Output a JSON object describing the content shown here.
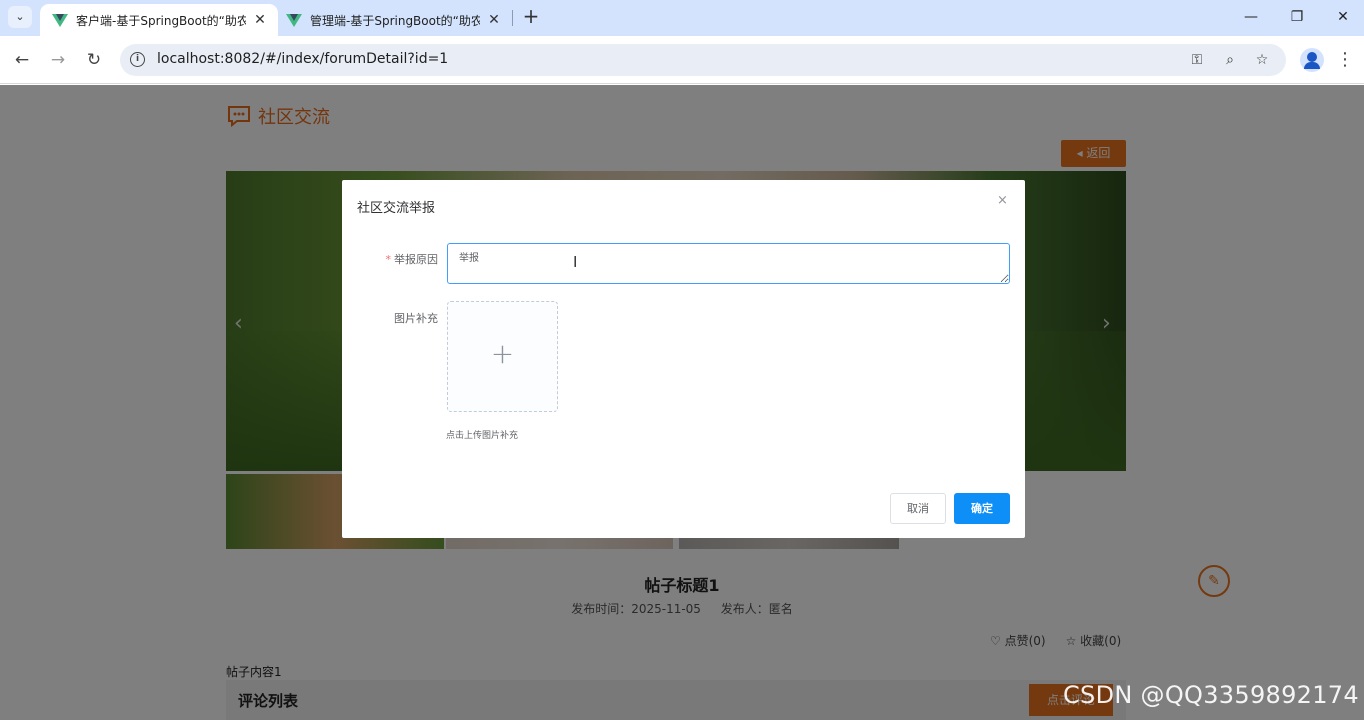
{
  "browser": {
    "tabs": [
      {
        "title": "客户端-基于SpringBoot的“助农",
        "active": true
      },
      {
        "title": "管理端-基于SpringBoot的“助农",
        "active": false
      }
    ],
    "url": "localhost:8082/#/index/forumDetail?id=1",
    "icons": [
      "tab-search-icon",
      "vue-favicon",
      "close-icon",
      "new-tab-icon",
      "minimize-icon",
      "restore-icon",
      "close-window-icon",
      "back-icon",
      "forward-icon",
      "reload-icon",
      "site-info-icon",
      "password-key-icon",
      "zoom-icon",
      "bookmark-star-icon",
      "profile-icon",
      "menu-icon"
    ]
  },
  "page": {
    "section_title": "社区交流",
    "back_label": "返回",
    "post_title": "帖子标题1",
    "publish_time_label": "发布时间：2025-11-05",
    "publisher_label": "发布人：匿名",
    "like_label": "点赞(0)",
    "favorite_label": "收藏(0)",
    "content": "帖子内容1",
    "comment_list_title": "评论列表",
    "comment_button": "点击评论"
  },
  "dialog": {
    "title": "社区交流举报",
    "close_symbol": "×",
    "reason_label": "举报原因",
    "reason_value": "举报",
    "image_label": "图片补充",
    "upload_tip": "点击上传图片补充",
    "cancel_label": "取消",
    "confirm_label": "确定"
  },
  "watermark": "CSDN @QQ3359892174",
  "colors": {
    "accent": "#e8731f",
    "primary": "#0e8ff7",
    "tab_bar": "#d3e3fd"
  }
}
